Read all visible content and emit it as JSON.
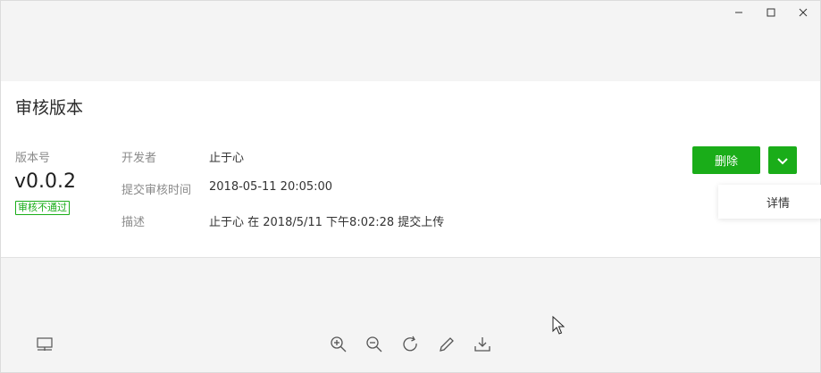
{
  "window": {
    "controls": [
      "minimize-icon",
      "maximize-icon",
      "close-icon"
    ]
  },
  "card": {
    "title": "审核版本",
    "version_label": "版本号",
    "version_value": "v0.0.2",
    "status_badge": "审核不通过",
    "fields": [
      {
        "label": "开发者",
        "value": "止于心"
      },
      {
        "label": "提交审核时间",
        "value": "2018-05-11 20:05:00"
      },
      {
        "label": "描述",
        "value": "止于心 在 2018/5/11 下午8:02:28 提交上传"
      }
    ],
    "delete_button": "删除",
    "more_button_icon": "chevron-down-icon",
    "dropdown_items": [
      "详情"
    ]
  },
  "toolbar": {
    "icons": [
      "layout-icon",
      "zoom-in-icon",
      "zoom-out-icon",
      "rotate-icon",
      "edit-icon",
      "download-icon"
    ]
  },
  "colors": {
    "accent": "#1aad19",
    "background": "#f4f4f4",
    "card": "#ffffff"
  }
}
